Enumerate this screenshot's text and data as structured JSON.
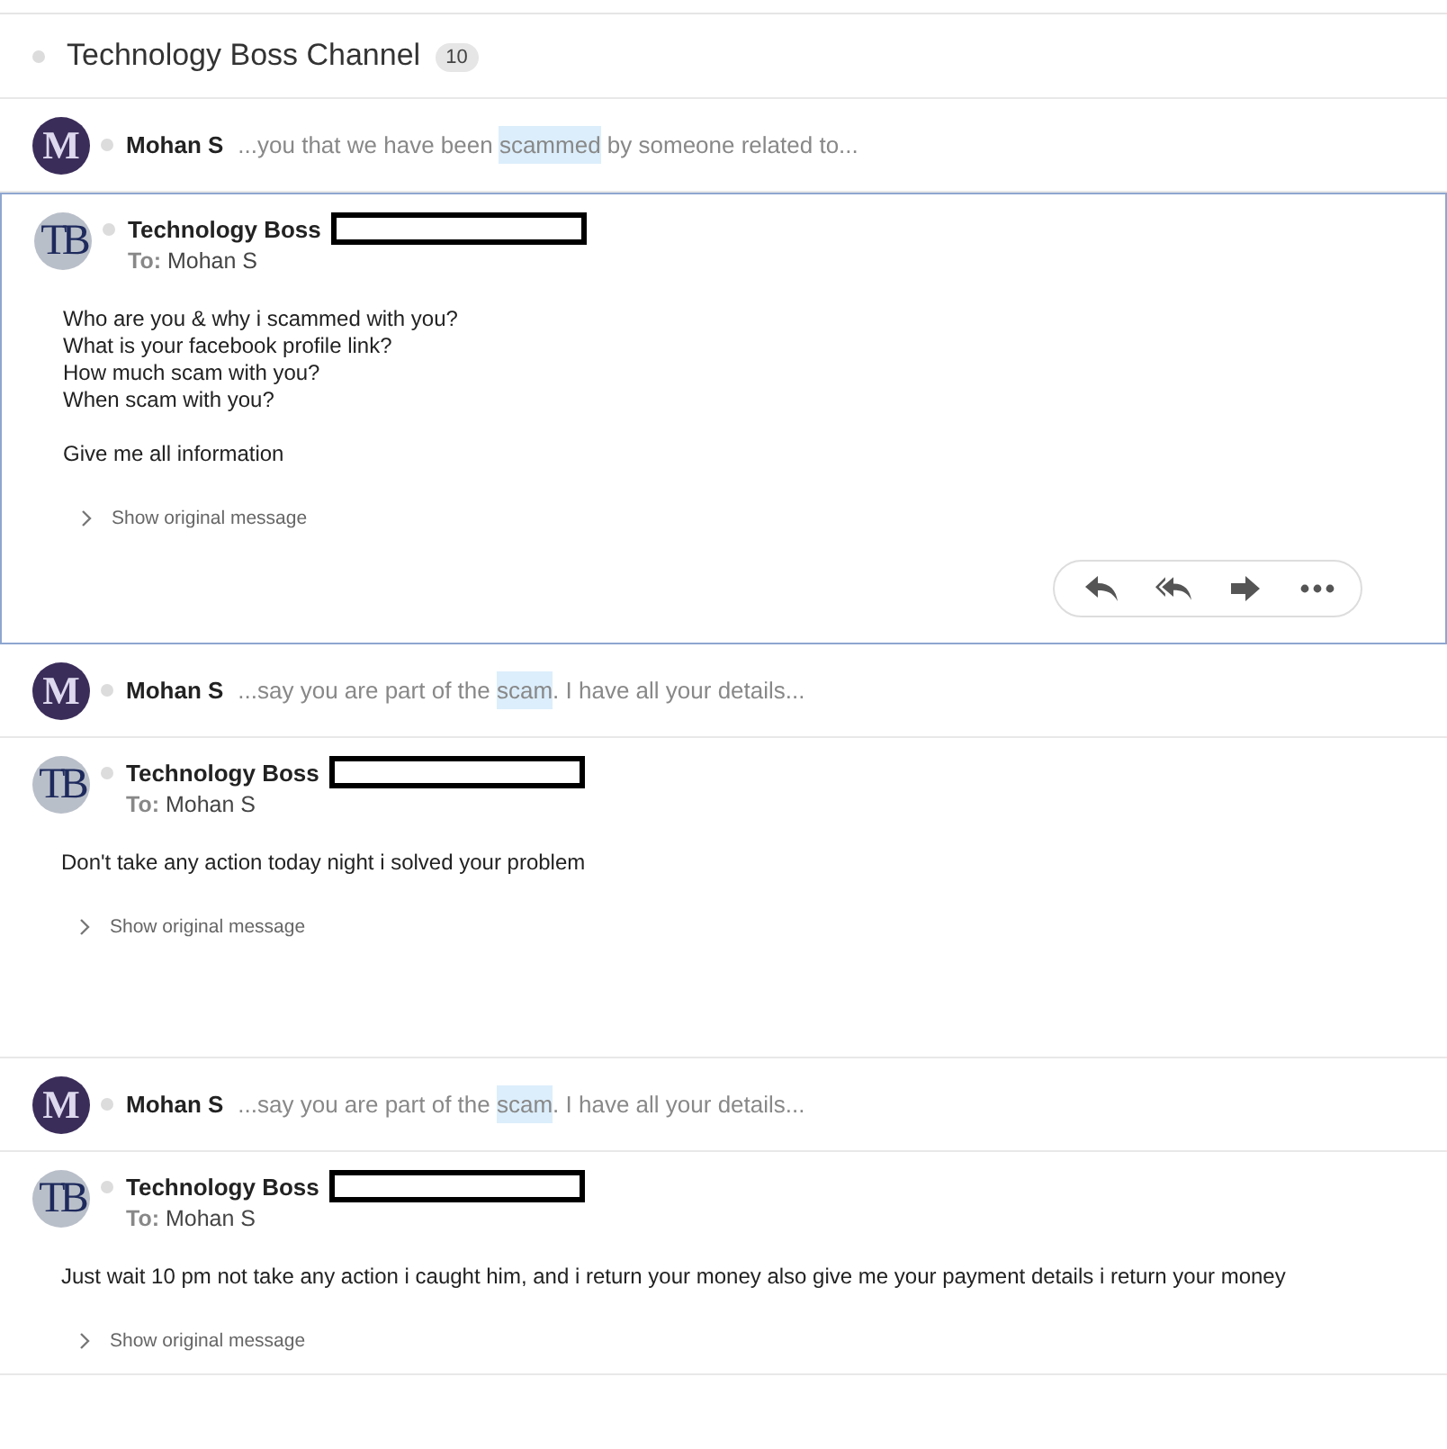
{
  "thread": {
    "title": "Technology Boss Channel",
    "count": "10"
  },
  "messages": [
    {
      "kind": "collapsed",
      "avatar": "M",
      "color": "#3b2d5a",
      "sender": "Mohan S",
      "snippet_before": "...you that we have been ",
      "highlight": "scammed",
      "snippet_after": " by someone related to..."
    },
    {
      "kind": "expanded",
      "selected": true,
      "avatar": "TB",
      "color": "#b9bfc9",
      "sender": "Technology Boss",
      "redacted": true,
      "to_label": "To:",
      "to": "Mohan S",
      "body": [
        "Who are you & why i scammed with you?\nWhat is your facebook profile link?\nHow much scam with you?\nWhen scam with you?",
        "Give me all information"
      ],
      "show_original": "Show original message",
      "actions": true
    },
    {
      "kind": "collapsed",
      "avatar": "M",
      "color": "#3b2d5a",
      "sender": "Mohan S",
      "snippet_before": "...say you are part of the ",
      "highlight": "scam",
      "snippet_after": ". I have all your details..."
    },
    {
      "kind": "expanded",
      "selected": false,
      "avatar": "TB",
      "color": "#b9bfc9",
      "sender": "Technology Boss",
      "redacted": true,
      "to_label": "To:",
      "to": "Mohan S",
      "body": [
        "Don't take any action today night i solved your problem"
      ],
      "show_original": "Show original message",
      "actions": false
    },
    {
      "kind": "collapsed",
      "avatar": "M",
      "color": "#3b2d5a",
      "sender": "Mohan S",
      "snippet_before": "...say you are part of the ",
      "highlight": "scam",
      "snippet_after": ". I have all your details..."
    },
    {
      "kind": "expanded",
      "selected": false,
      "avatar": "TB",
      "color": "#b9bfc9",
      "sender": "Technology Boss",
      "redacted": true,
      "to_label": "To:",
      "to": "Mohan S",
      "body": [
        "Just wait 10 pm not take any action i caught him, and i return your money also give me your payment details i return your money"
      ],
      "show_original": "Show original message",
      "actions": false
    }
  ]
}
